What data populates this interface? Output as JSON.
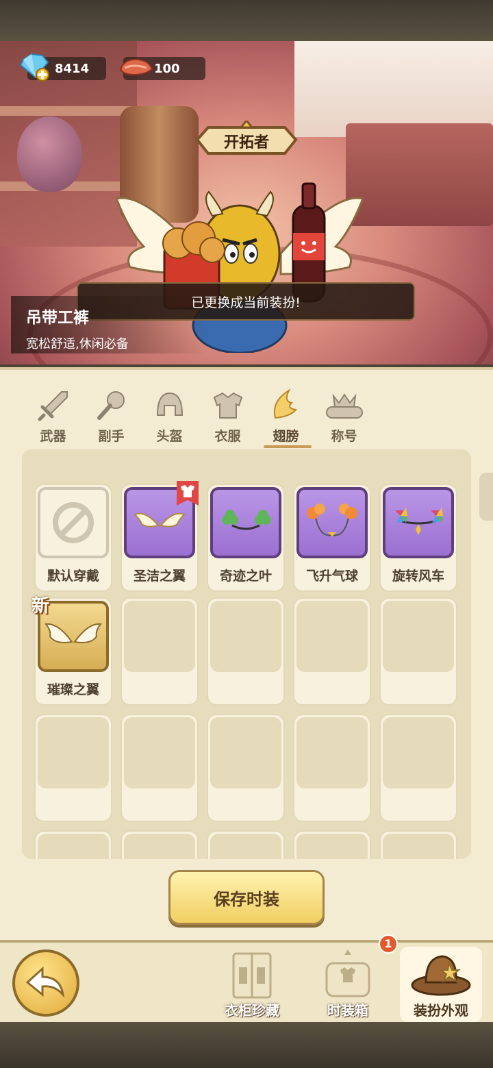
{
  "currency": {
    "gems": "8414",
    "meat": "100"
  },
  "title_badge": "开拓者",
  "toast": "已更换成当前装扮!",
  "item_info": {
    "name": "吊带工裤",
    "desc": "宽松舒适,休闲必备"
  },
  "tabs": [
    {
      "label": "武器",
      "icon": "sword-icon"
    },
    {
      "label": "副手",
      "icon": "offhand-icon"
    },
    {
      "label": "头盔",
      "icon": "helmet-icon"
    },
    {
      "label": "衣服",
      "icon": "armor-icon"
    },
    {
      "label": "翅膀",
      "icon": "wing-icon",
      "active": true
    },
    {
      "label": "称号",
      "icon": "title-icon"
    }
  ],
  "items": [
    {
      "label": "默认穿戴",
      "style": "default"
    },
    {
      "label": "圣洁之翼",
      "style": "purple",
      "equipped": true
    },
    {
      "label": "奇迹之叶",
      "style": "purple"
    },
    {
      "label": "飞升气球",
      "style": "purple"
    },
    {
      "label": "旋转风车",
      "style": "purple"
    },
    {
      "label": "璀璨之翼",
      "style": "gold",
      "new": true
    }
  ],
  "new_badge": "新",
  "save_button": "保存时装",
  "bottom_nav": {
    "wardrobe": "衣柜珍藏",
    "fashion_box": "时装箱",
    "appearance": "装扮外观",
    "fashion_box_badge": "1"
  },
  "colors": {
    "accent": "#c99a55",
    "panel": "#f3ecd2",
    "purple_frame": "#9b70d1",
    "gold_frame": "#d7ae55"
  }
}
